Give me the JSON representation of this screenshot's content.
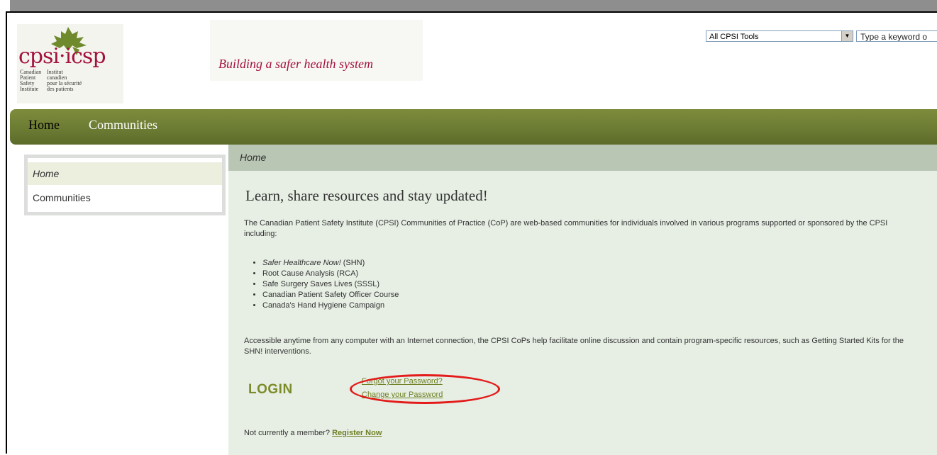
{
  "header": {
    "logo": {
      "wordmark": "cpsi·icsp",
      "en_lines": "Canadian\nPatient\nSafety\nInstitute",
      "fr_lines": "Institut\ncanadien\npour la sécurité\ndes patients"
    },
    "tagline": "Building a safer health system",
    "tool_select": {
      "selected": "All CPSI Tools"
    },
    "search": {
      "placeholder": "Type a keyword o"
    }
  },
  "nav": {
    "items": [
      {
        "label": "Home"
      },
      {
        "label": "Communities"
      }
    ]
  },
  "sidebar": {
    "items": [
      {
        "label": "Home"
      },
      {
        "label": "Communities"
      }
    ]
  },
  "main": {
    "breadcrumb": "Home",
    "heading": "Learn, share resources and stay updated!",
    "intro": "The Canadian Patient Safety Institute (CPSI) Communities of Practice (CoP) are web-based communities for individuals involved in various programs supported or sponsored by the CPSI including:",
    "programs": [
      {
        "title": "Safer Healthcare Now!",
        "suffix": " (SHN)"
      },
      {
        "title": "Root Cause Analysis (RCA)",
        "suffix": ""
      },
      {
        "title": "Safe Surgery Saves Lives (SSSL)",
        "suffix": ""
      },
      {
        "title": "Canadian Patient Safety Officer Course",
        "suffix": ""
      },
      {
        "title": "Canada's Hand Hygiene Campaign",
        "suffix": ""
      }
    ],
    "access": "Accessible anytime from any computer with an Internet connection, the CPSI CoPs help facilitate online discussion and contain program-specific resources, such as Getting Started Kits for the SHN! interventions.",
    "login_label": "LOGIN",
    "forgot_label": "Forgot your Password?",
    "change_label": "Change your Password",
    "member_prompt": "Not currently a member?",
    "register_label": "Register Now"
  },
  "colors": {
    "brand": "#a3123c",
    "nav_green": "#6a7a32",
    "link_green": "#6f7f24",
    "highlight": "#e31b1b"
  },
  "icons": {
    "logo_mark": "maple-leaf-icon",
    "select_arrow": "chevron-down-icon"
  }
}
